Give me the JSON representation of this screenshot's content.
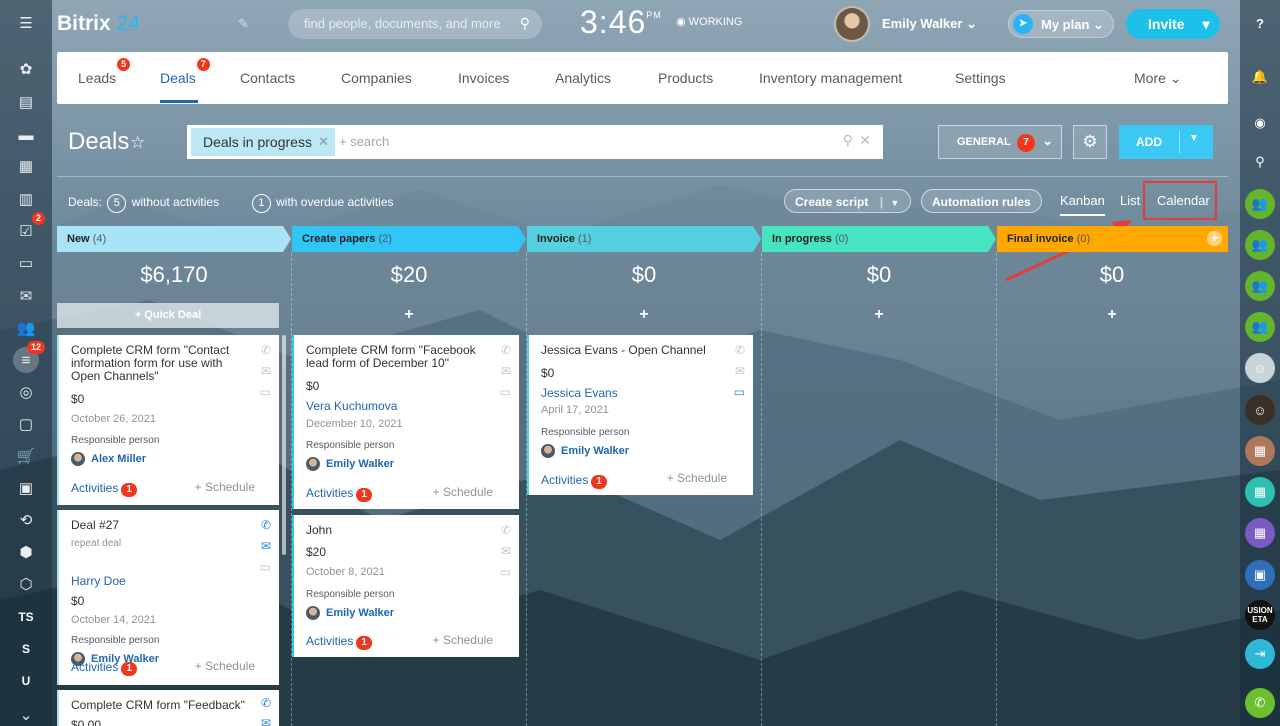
{
  "app": {
    "logo_main": "Bitrix",
    "logo_num": "24",
    "search_placeholder": "find people, documents, and more",
    "clock": "3:46",
    "clock_ampm": "PM",
    "working": "WORKING",
    "user_name": "Emily Walker",
    "myplan": "My plan",
    "invite": "Invite"
  },
  "left_sidebar": {
    "tasks_badge": "2",
    "crm_badge": "12",
    "labels": [
      "TS",
      "S",
      "U"
    ]
  },
  "right_sidebar": {
    "label_text": "USION ETA"
  },
  "tabs": [
    {
      "label": "Leads",
      "badge": "5"
    },
    {
      "label": "Deals",
      "badge": "7"
    },
    {
      "label": "Contacts"
    },
    {
      "label": "Companies"
    },
    {
      "label": "Invoices"
    },
    {
      "label": "Analytics"
    },
    {
      "label": "Products"
    },
    {
      "label": "Inventory management"
    },
    {
      "label": "Settings"
    },
    {
      "label": "More"
    }
  ],
  "header": {
    "title": "Deals",
    "filter_chip": "Deals in progress",
    "filter_placeholder": "+ search",
    "general": "GENERAL",
    "general_badge": "7",
    "add": "ADD"
  },
  "stats": {
    "prefix": "Deals:",
    "without_count": "5",
    "without_label": "without activities",
    "overdue_count": "1",
    "overdue_label": "with overdue activities"
  },
  "toolbar": {
    "create_script": "Create script",
    "automation_rules": "Automation rules",
    "kanban": "Kanban",
    "list": "List",
    "calendar": "Calendar"
  },
  "columns": [
    {
      "name": "New",
      "count": "(4)",
      "sum": "$6,170",
      "color": "#a7e4f8"
    },
    {
      "name": "Create papers",
      "count": "(2)",
      "sum": "$20",
      "color": "#2fc6f6"
    },
    {
      "name": "Invoice",
      "count": "(1)",
      "sum": "$0",
      "color": "#55d0e0"
    },
    {
      "name": "In progress",
      "count": "(0)",
      "sum": "$0",
      "color": "#47e4c2"
    },
    {
      "name": "Final invoice",
      "count": "(0)",
      "sum": "$0",
      "color": "#ffa900"
    }
  ],
  "quick_deal": "+ Quick Deal",
  "cards": {
    "c1": {
      "title": "Complete CRM form \"Contact information form for use with Open Channels\"",
      "amount": "$0",
      "date": "October 26, 2021",
      "resp_label": "Responsible person",
      "person": "Alex Miller",
      "activities": "Activities",
      "act_badge": "1",
      "schedule": "+ Schedule"
    },
    "c2": {
      "title": "Deal #27",
      "sub": "repeat deal",
      "contact": "Harry Doe",
      "amount": "$0",
      "date": "October 14, 2021",
      "resp_label": "Responsible person",
      "person": "Emily Walker",
      "activities": "Activities",
      "act_badge": "1",
      "schedule": "+ Schedule"
    },
    "c3": {
      "title": "Complete CRM form \"Feedback\"",
      "amount": "$0 00"
    },
    "c4": {
      "title": "Complete CRM form \"Facebook lead form of December 10\"",
      "amount": "$0",
      "contact": "Vera Kuchumova",
      "date": "December 10, 2021",
      "resp_label": "Responsible person",
      "person": "Emily Walker",
      "activities": "Activities",
      "act_badge": "1",
      "schedule": "+ Schedule"
    },
    "c5": {
      "title": "John",
      "amount": "$20",
      "date": "October 8, 2021",
      "resp_label": "Responsible person",
      "person": "Emily Walker",
      "activities": "Activities",
      "act_badge": "1",
      "schedule": "+ Schedule"
    },
    "c6": {
      "title": "Jessica Evans - Open Channel",
      "amount": "$0",
      "contact": "Jessica Evans",
      "date": "April 17, 2021",
      "resp_label": "Responsible person",
      "person": "Emily Walker",
      "activities": "Activities",
      "act_badge": "1",
      "schedule": "+ Schedule"
    }
  },
  "colors": {
    "accent": "#2067b0",
    "badge": "#f0371e",
    "add_button": "#3bc8f5",
    "highlight_box": "#e53b3b"
  }
}
